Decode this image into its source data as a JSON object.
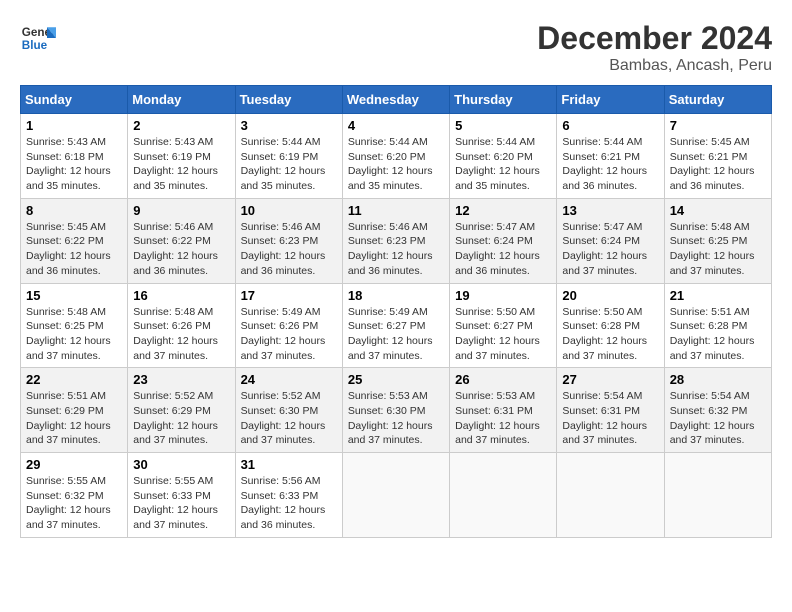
{
  "header": {
    "logo_line1": "General",
    "logo_line2": "Blue",
    "title": "December 2024",
    "subtitle": "Bambas, Ancash, Peru"
  },
  "weekdays": [
    "Sunday",
    "Monday",
    "Tuesday",
    "Wednesday",
    "Thursday",
    "Friday",
    "Saturday"
  ],
  "weeks": [
    [
      {
        "day": "1",
        "sunrise": "5:43 AM",
        "sunset": "6:18 PM",
        "daylight": "12 hours and 35 minutes."
      },
      {
        "day": "2",
        "sunrise": "5:43 AM",
        "sunset": "6:19 PM",
        "daylight": "12 hours and 35 minutes."
      },
      {
        "day": "3",
        "sunrise": "5:44 AM",
        "sunset": "6:19 PM",
        "daylight": "12 hours and 35 minutes."
      },
      {
        "day": "4",
        "sunrise": "5:44 AM",
        "sunset": "6:20 PM",
        "daylight": "12 hours and 35 minutes."
      },
      {
        "day": "5",
        "sunrise": "5:44 AM",
        "sunset": "6:20 PM",
        "daylight": "12 hours and 35 minutes."
      },
      {
        "day": "6",
        "sunrise": "5:44 AM",
        "sunset": "6:21 PM",
        "daylight": "12 hours and 36 minutes."
      },
      {
        "day": "7",
        "sunrise": "5:45 AM",
        "sunset": "6:21 PM",
        "daylight": "12 hours and 36 minutes."
      }
    ],
    [
      {
        "day": "8",
        "sunrise": "5:45 AM",
        "sunset": "6:22 PM",
        "daylight": "12 hours and 36 minutes."
      },
      {
        "day": "9",
        "sunrise": "5:46 AM",
        "sunset": "6:22 PM",
        "daylight": "12 hours and 36 minutes."
      },
      {
        "day": "10",
        "sunrise": "5:46 AM",
        "sunset": "6:23 PM",
        "daylight": "12 hours and 36 minutes."
      },
      {
        "day": "11",
        "sunrise": "5:46 AM",
        "sunset": "6:23 PM",
        "daylight": "12 hours and 36 minutes."
      },
      {
        "day": "12",
        "sunrise": "5:47 AM",
        "sunset": "6:24 PM",
        "daylight": "12 hours and 36 minutes."
      },
      {
        "day": "13",
        "sunrise": "5:47 AM",
        "sunset": "6:24 PM",
        "daylight": "12 hours and 37 minutes."
      },
      {
        "day": "14",
        "sunrise": "5:48 AM",
        "sunset": "6:25 PM",
        "daylight": "12 hours and 37 minutes."
      }
    ],
    [
      {
        "day": "15",
        "sunrise": "5:48 AM",
        "sunset": "6:25 PM",
        "daylight": "12 hours and 37 minutes."
      },
      {
        "day": "16",
        "sunrise": "5:48 AM",
        "sunset": "6:26 PM",
        "daylight": "12 hours and 37 minutes."
      },
      {
        "day": "17",
        "sunrise": "5:49 AM",
        "sunset": "6:26 PM",
        "daylight": "12 hours and 37 minutes."
      },
      {
        "day": "18",
        "sunrise": "5:49 AM",
        "sunset": "6:27 PM",
        "daylight": "12 hours and 37 minutes."
      },
      {
        "day": "19",
        "sunrise": "5:50 AM",
        "sunset": "6:27 PM",
        "daylight": "12 hours and 37 minutes."
      },
      {
        "day": "20",
        "sunrise": "5:50 AM",
        "sunset": "6:28 PM",
        "daylight": "12 hours and 37 minutes."
      },
      {
        "day": "21",
        "sunrise": "5:51 AM",
        "sunset": "6:28 PM",
        "daylight": "12 hours and 37 minutes."
      }
    ],
    [
      {
        "day": "22",
        "sunrise": "5:51 AM",
        "sunset": "6:29 PM",
        "daylight": "12 hours and 37 minutes."
      },
      {
        "day": "23",
        "sunrise": "5:52 AM",
        "sunset": "6:29 PM",
        "daylight": "12 hours and 37 minutes."
      },
      {
        "day": "24",
        "sunrise": "5:52 AM",
        "sunset": "6:30 PM",
        "daylight": "12 hours and 37 minutes."
      },
      {
        "day": "25",
        "sunrise": "5:53 AM",
        "sunset": "6:30 PM",
        "daylight": "12 hours and 37 minutes."
      },
      {
        "day": "26",
        "sunrise": "5:53 AM",
        "sunset": "6:31 PM",
        "daylight": "12 hours and 37 minutes."
      },
      {
        "day": "27",
        "sunrise": "5:54 AM",
        "sunset": "6:31 PM",
        "daylight": "12 hours and 37 minutes."
      },
      {
        "day": "28",
        "sunrise": "5:54 AM",
        "sunset": "6:32 PM",
        "daylight": "12 hours and 37 minutes."
      }
    ],
    [
      {
        "day": "29",
        "sunrise": "5:55 AM",
        "sunset": "6:32 PM",
        "daylight": "12 hours and 37 minutes."
      },
      {
        "day": "30",
        "sunrise": "5:55 AM",
        "sunset": "6:33 PM",
        "daylight": "12 hours and 37 minutes."
      },
      {
        "day": "31",
        "sunrise": "5:56 AM",
        "sunset": "6:33 PM",
        "daylight": "12 hours and 36 minutes."
      },
      null,
      null,
      null,
      null
    ]
  ]
}
